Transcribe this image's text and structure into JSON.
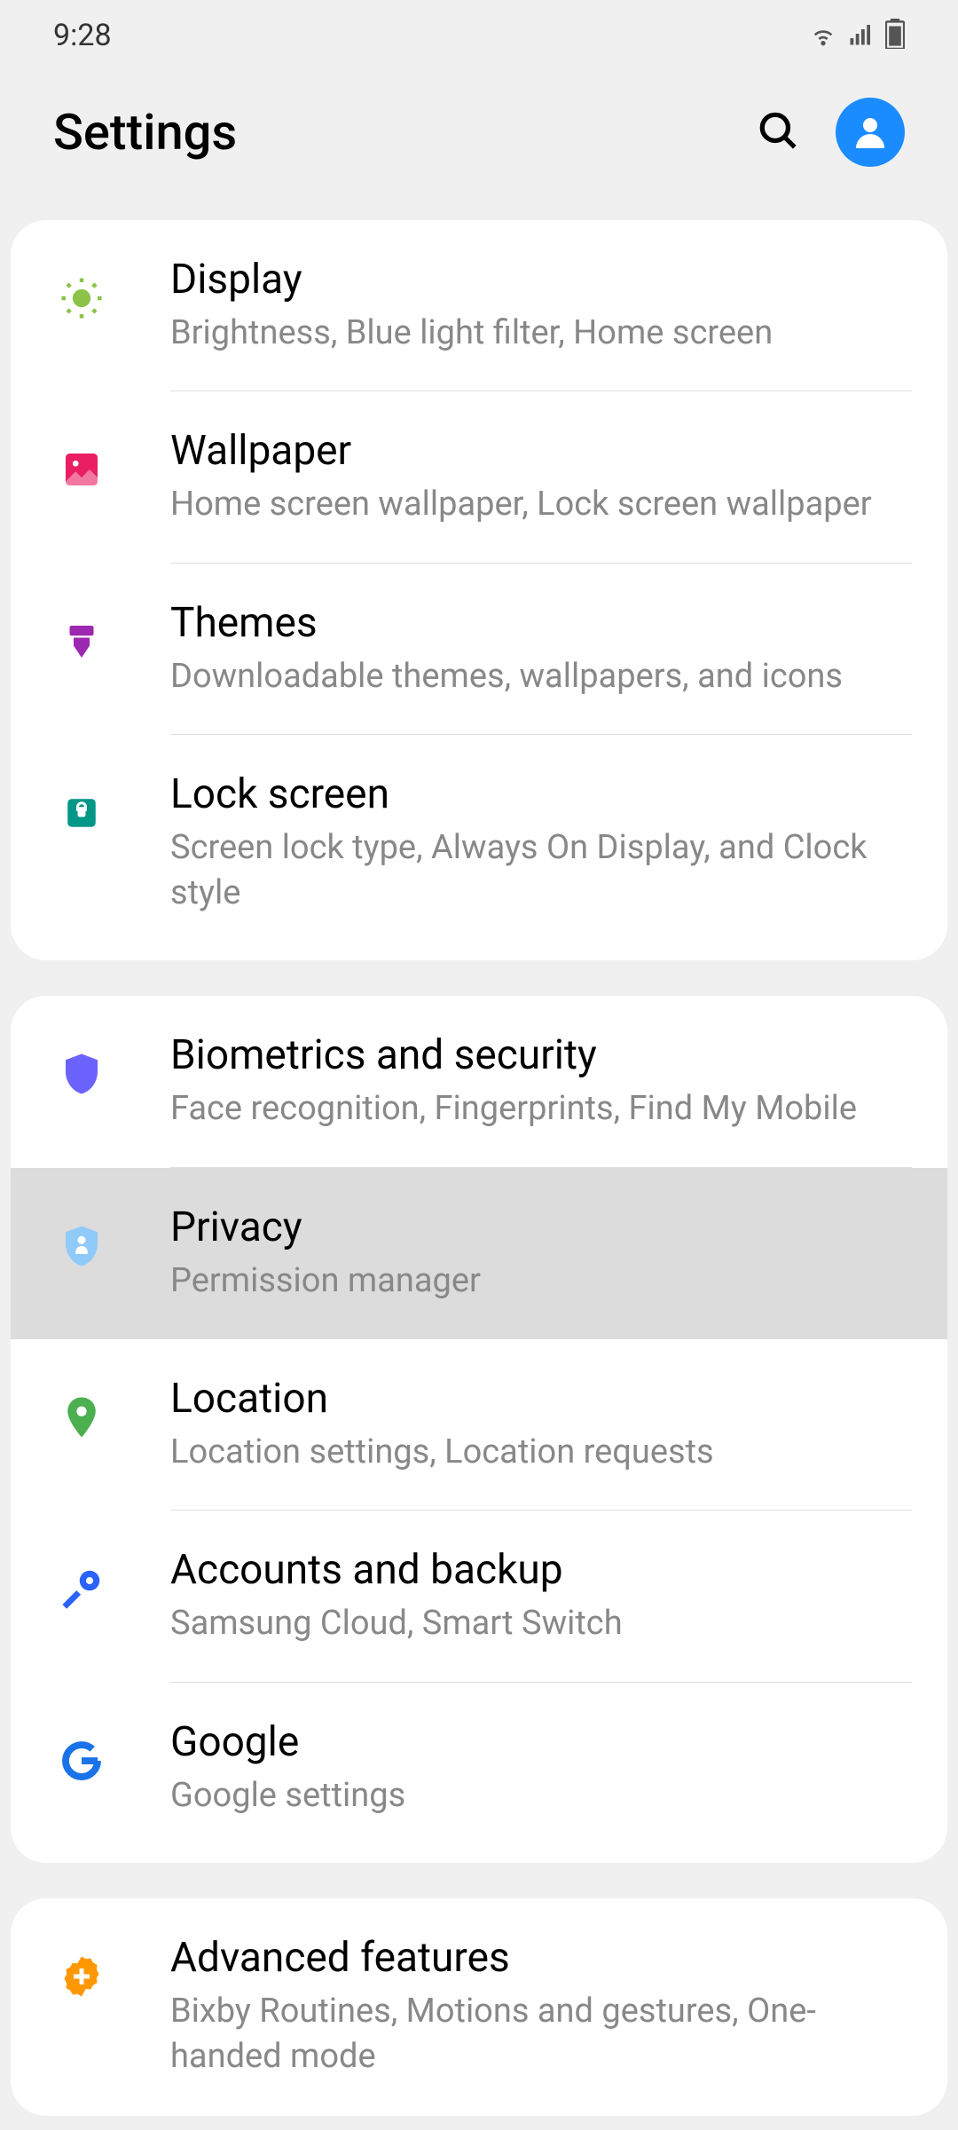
{
  "status": {
    "time": "9:28"
  },
  "header": {
    "title": "Settings"
  },
  "groups": [
    {
      "items": [
        {
          "id": "display",
          "title": "Display",
          "subtitle": "Brightness, Blue light filter, Home screen",
          "icon": "brightness"
        },
        {
          "id": "wallpaper",
          "title": "Wallpaper",
          "subtitle": "Home screen wallpaper, Lock screen wallpaper",
          "icon": "wallpaper"
        },
        {
          "id": "themes",
          "title": "Themes",
          "subtitle": "Downloadable themes, wallpapers, and icons",
          "icon": "themes"
        },
        {
          "id": "lock-screen",
          "title": "Lock screen",
          "subtitle": "Screen lock type, Always On Display, and Clock style",
          "icon": "lock"
        }
      ]
    },
    {
      "items": [
        {
          "id": "biometrics",
          "title": "Biometrics and security",
          "subtitle": "Face recognition, Fingerprints, Find My Mobile",
          "icon": "security"
        },
        {
          "id": "privacy",
          "title": "Privacy",
          "subtitle": "Permission manager",
          "icon": "privacy",
          "highlighted": true
        },
        {
          "id": "location",
          "title": "Location",
          "subtitle": "Location settings, Location requests",
          "icon": "location"
        },
        {
          "id": "accounts",
          "title": "Accounts and backup",
          "subtitle": "Samsung Cloud, Smart Switch",
          "icon": "accounts"
        },
        {
          "id": "google",
          "title": "Google",
          "subtitle": "Google settings",
          "icon": "google"
        }
      ]
    },
    {
      "items": [
        {
          "id": "advanced",
          "title": "Advanced features",
          "subtitle": "Bixby Routines, Motions and gestures, One-handed mode",
          "icon": "advanced"
        }
      ]
    }
  ]
}
